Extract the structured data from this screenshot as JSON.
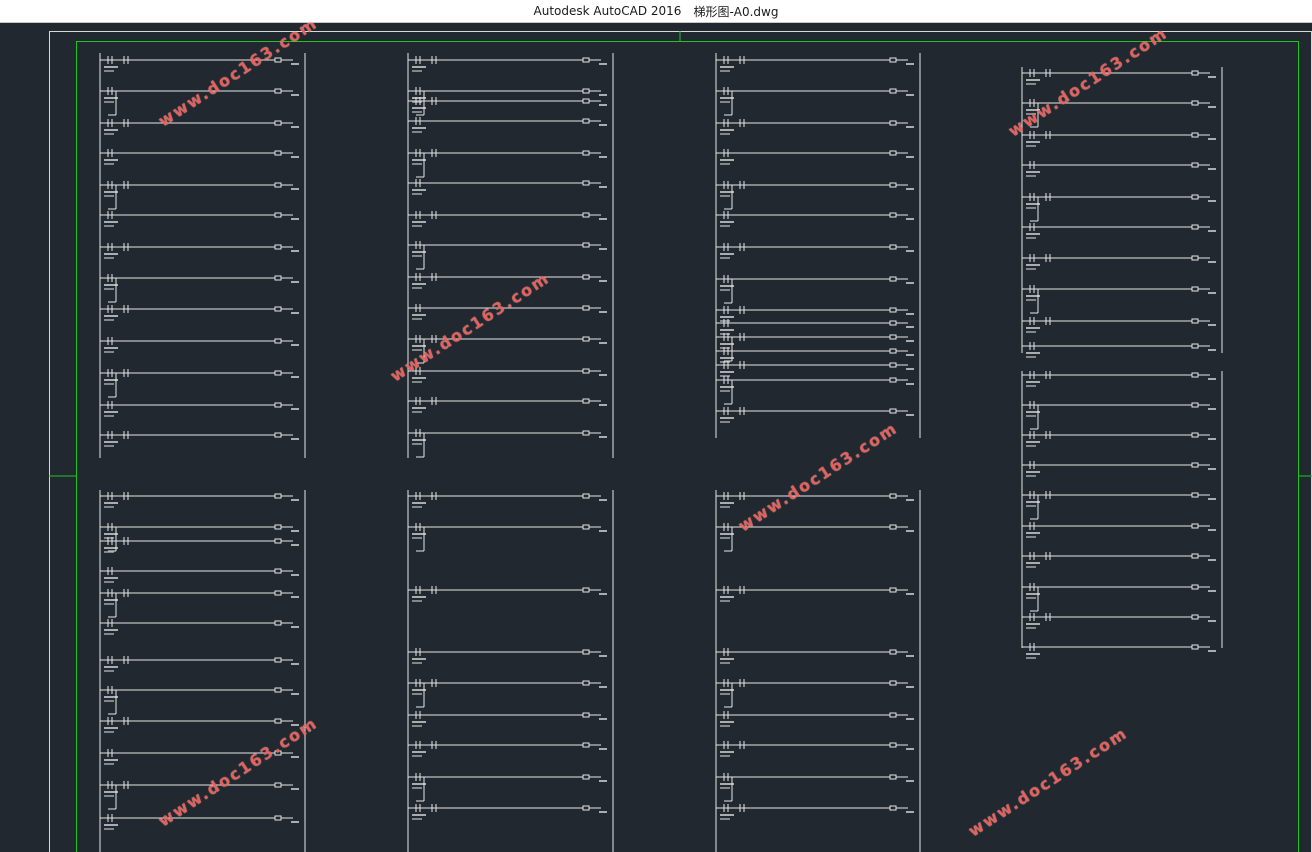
{
  "window": {
    "app_name": "Autodesk AutoCAD 2016",
    "file_name": "梯形图-A0.dwg"
  },
  "watermark": {
    "text": "www.doc163.com",
    "color": "#ec5a54"
  },
  "colors": {
    "canvas": "#212830",
    "frame": "#22c222",
    "outer_frame": "#d8d8d8",
    "wires": "#e6e6e6"
  }
}
